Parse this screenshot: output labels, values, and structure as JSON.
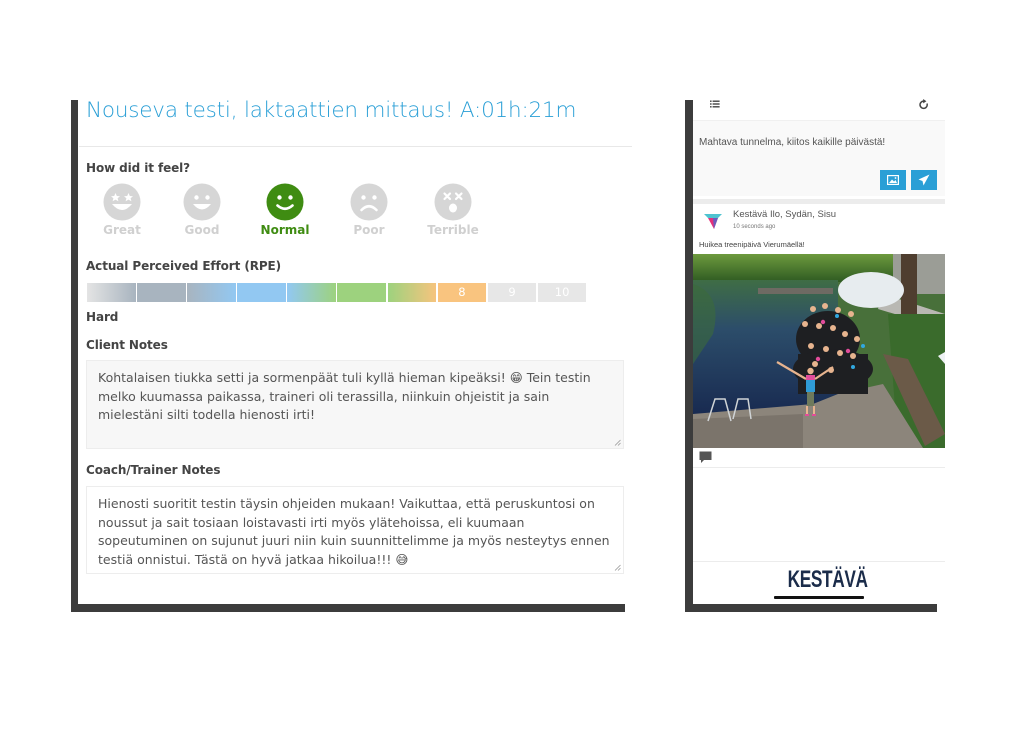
{
  "workout": {
    "title": "Nouseva testi, laktaattien mittaus! A:01h:21m",
    "accent_color": "#2a9fd6"
  },
  "feel": {
    "label": "How did it feel?",
    "selected": "Normal",
    "options": [
      {
        "label": "Great",
        "icon": "star-eyes-face-icon"
      },
      {
        "label": "Good",
        "icon": "smile-face-icon"
      },
      {
        "label": "Normal",
        "icon": "smile-face-icon"
      },
      {
        "label": "Poor",
        "icon": "sad-face-icon"
      },
      {
        "label": "Terrible",
        "icon": "dizzy-face-icon"
      }
    ],
    "active_color": "#3f8c12",
    "inactive_color": "#d6d6d6"
  },
  "rpe": {
    "label": "Actual Perceived Effort (RPE)",
    "value": 8,
    "max": 10,
    "level_label": "Hard",
    "segments": [
      {
        "value": 1,
        "label": ""
      },
      {
        "value": 2,
        "label": ""
      },
      {
        "value": 3,
        "label": ""
      },
      {
        "value": 4,
        "label": ""
      },
      {
        "value": 5,
        "label": ""
      },
      {
        "value": 6,
        "label": ""
      },
      {
        "value": 7,
        "label": ""
      },
      {
        "value": 8,
        "label": "8"
      },
      {
        "value": 9,
        "label": "9"
      },
      {
        "value": 10,
        "label": "10"
      }
    ]
  },
  "client_notes": {
    "label": "Client Notes",
    "text": "Kohtalaisen tiukka setti ja sormenpäät tuli kyllä hieman kipeäksi! 😁 Tein testin melko kuumassa paikassa, traineri oli terassilla, niinkuin ohjeistit ja sain mielestäni silti todella hienosti irti!"
  },
  "coach_notes": {
    "label": "Coach/Trainer Notes",
    "text": "Hienosti suoritit testin täysin ohjeiden mukaan! Vaikuttaa, että peruskuntosi on noussut ja sait tosiaan loistavasti irti myös ylätehoissa, eli kuumaan sopeutuminen on sujunut juuri niin kuin suunnittelimme ja myös nesteytys ennen testiä onnistui. Tästä on hyvä jatkaa hikoilua!!! 😅"
  },
  "feed": {
    "compose_text": "Mahtava tunnelma, kiitos kaikille päivästä!",
    "post": {
      "author": "Kestävä Ilo, Sydän, Sisu",
      "time": "10 seconds ago",
      "text": "Huikea treenipäivä Vierumäellä!"
    },
    "brand": "KESTÄVÄ"
  }
}
